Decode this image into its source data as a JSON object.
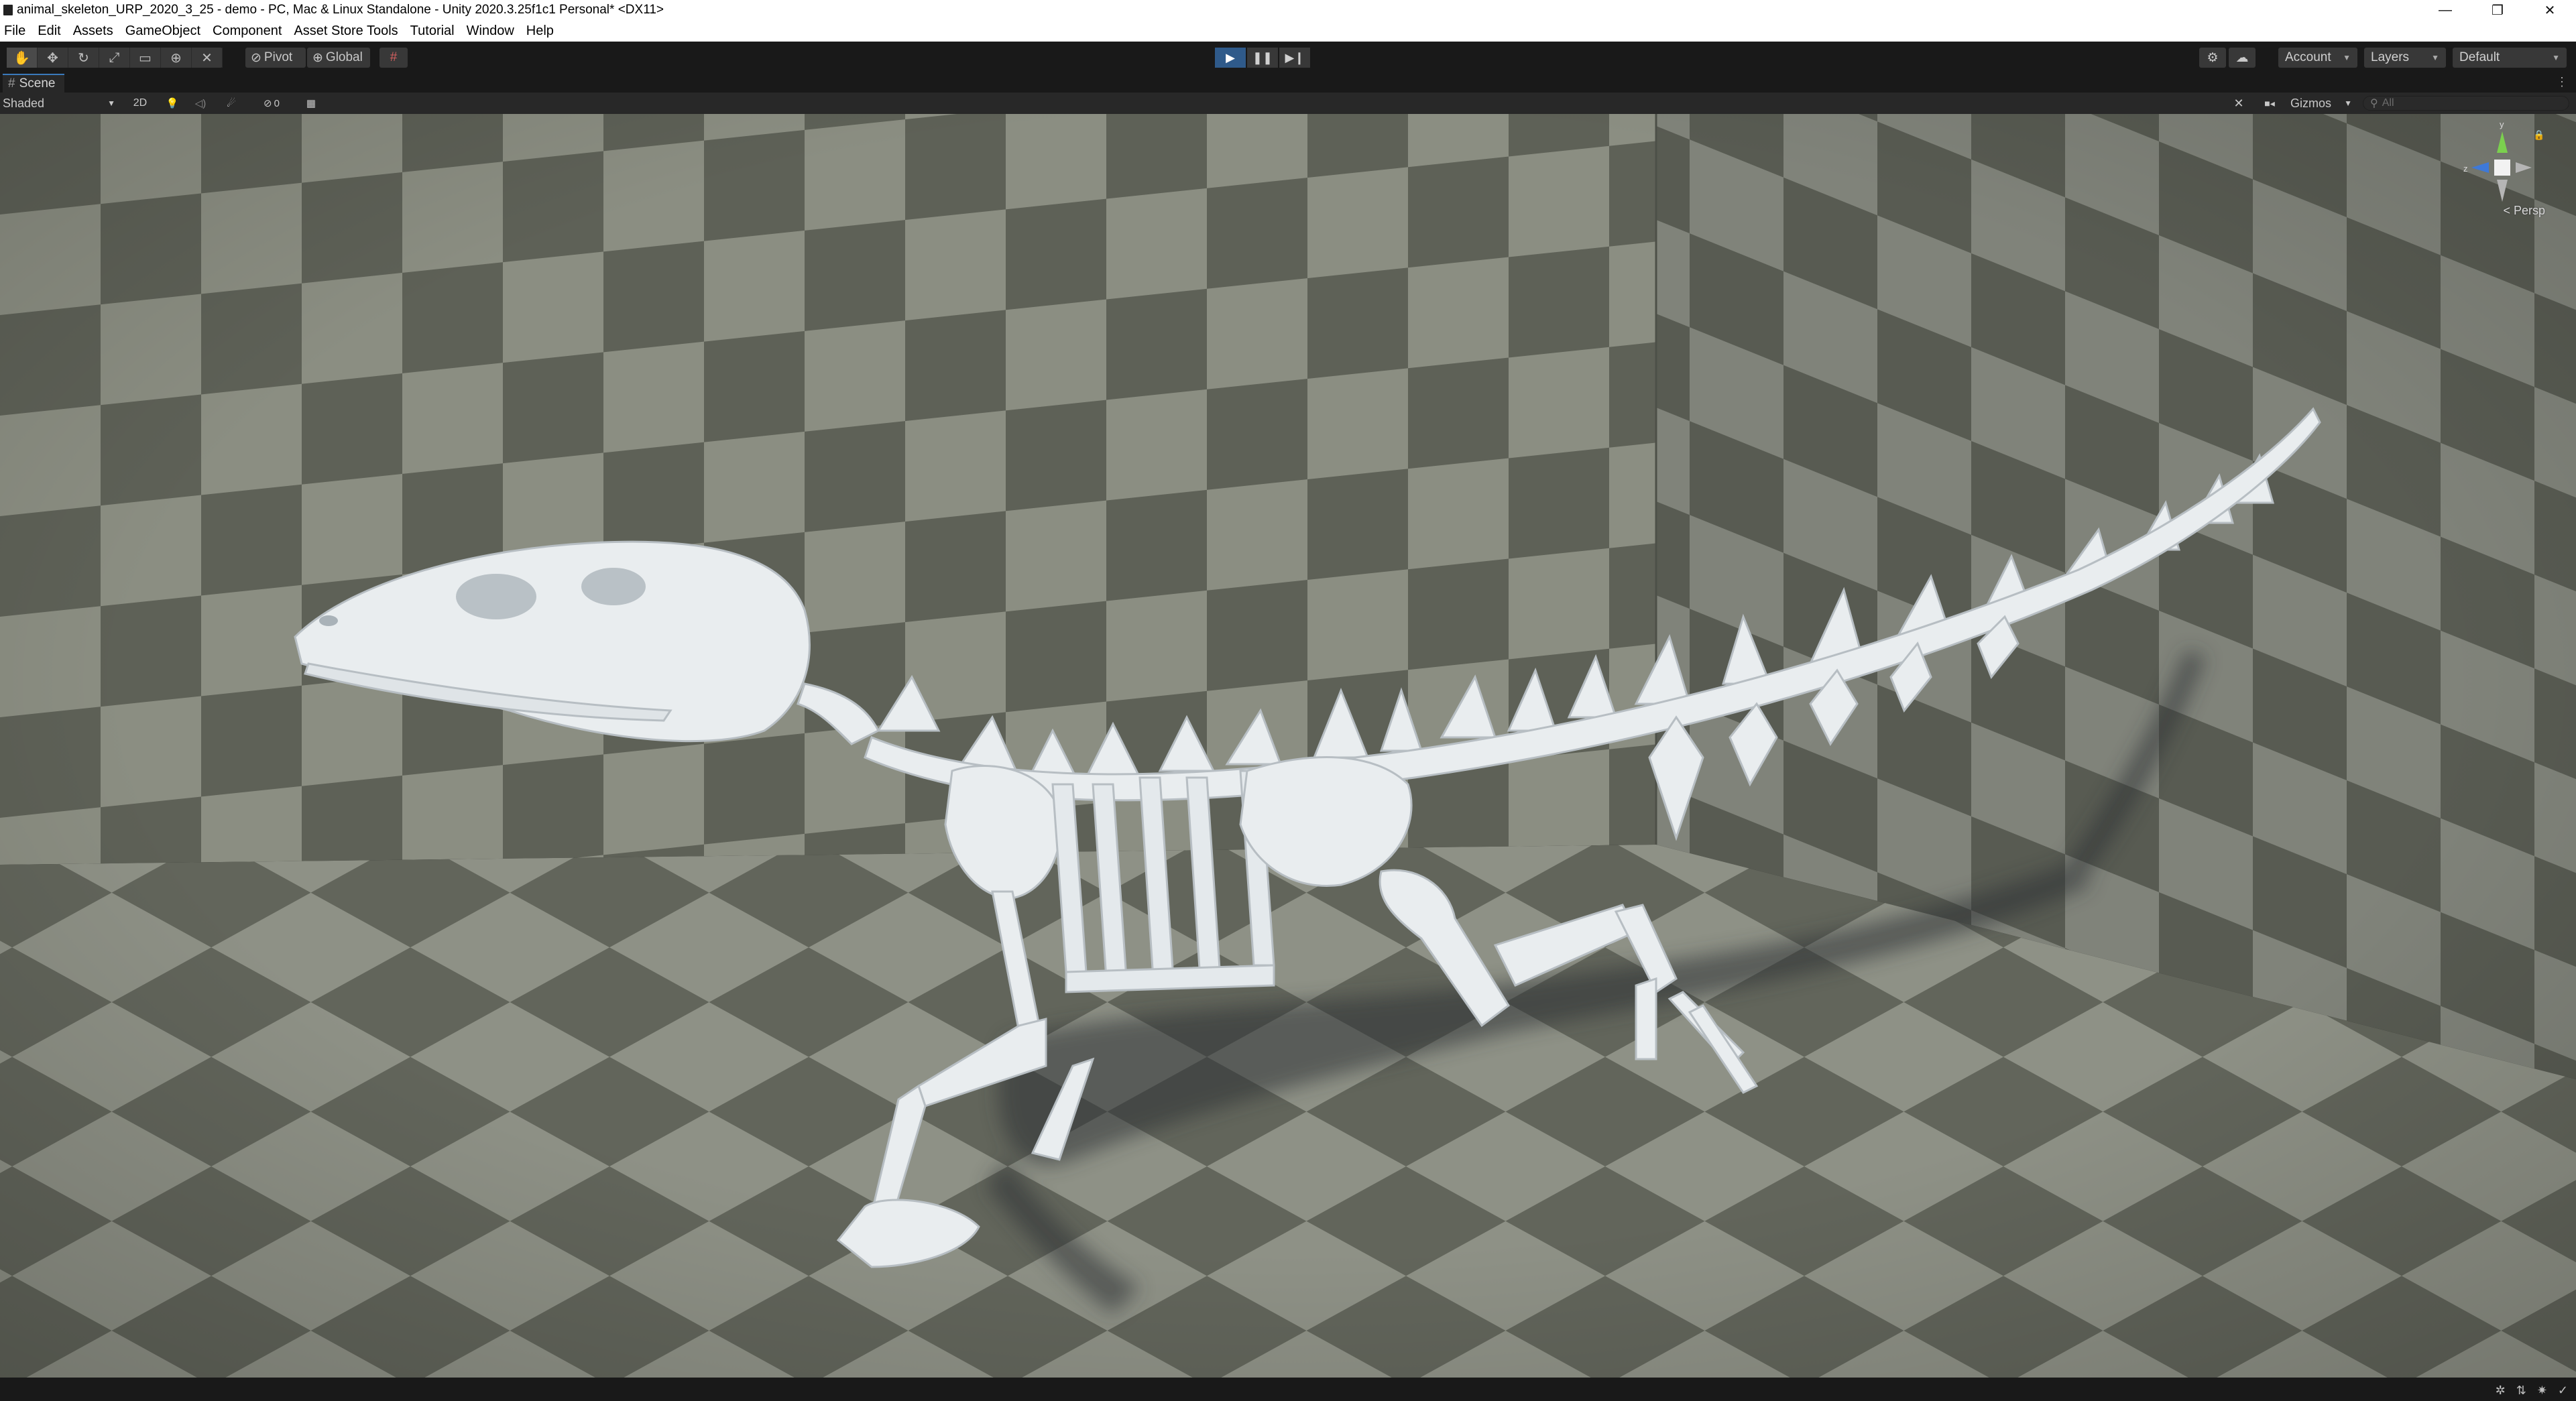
{
  "window": {
    "title": "animal_skeleton_URP_2020_3_25 - demo - PC, Mac & Linux Standalone - Unity 2020.3.25f1c1 Personal* <DX11>",
    "controls": {
      "minimize": "—",
      "restore": "❐",
      "close": "✕"
    }
  },
  "menu": [
    "File",
    "Edit",
    "Assets",
    "GameObject",
    "Component",
    "Asset Store Tools",
    "Tutorial",
    "Window",
    "Help"
  ],
  "toolbar": {
    "tools": [
      "hand-tool-icon",
      "move-tool-icon",
      "rotate-tool-icon",
      "scale-tool-icon",
      "rect-tool-icon",
      "transform-tool-icon",
      "custom-tool-icon"
    ],
    "tool_glyphs": [
      "✋",
      "✥",
      "↻",
      "⤢",
      "▭",
      "⊕",
      "✕"
    ],
    "pivot_label": "Pivot",
    "global_label": "Global",
    "snap_glyph": "#",
    "play": {
      "play_glyph": "▶",
      "pause_glyph": "❚❚",
      "step_glyph": "▶❙",
      "is_playing": true
    },
    "account_label": "Account",
    "layers_label": "Layers",
    "layout_label": "Default",
    "settings_glyph": "⚙",
    "cloud_glyph": "☁"
  },
  "scene_tab": {
    "icon_glyph": "#",
    "label": "Scene",
    "menu_glyph": "⋮"
  },
  "scene_toolbar": {
    "draw_mode": "Shaded",
    "mode_2d": "2D",
    "light_glyph": "💡",
    "audio_glyph": "◁)",
    "fx_glyph": "☄",
    "hidden_count": "0",
    "grid_glyph": "▦",
    "tools_glyph": "✕",
    "camera_glyph": "■◂",
    "gizmos_label": "Gizmos",
    "search_placeholder": "All"
  },
  "viewport": {
    "projection": "< Persp",
    "gizmo_axes": {
      "y": "y",
      "z": "z"
    }
  },
  "colors": {
    "editor_bg": "#191919",
    "panel_bg": "#282828",
    "accent_blue": "#3a79bb",
    "checker_light": "#8b8e82",
    "checker_dark": "#5e6157",
    "bone": "#e9edef"
  }
}
